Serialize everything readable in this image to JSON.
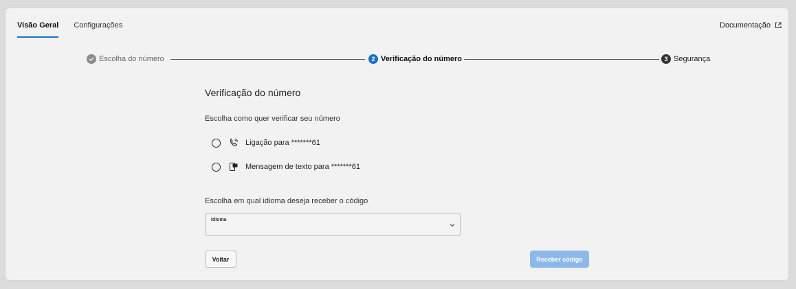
{
  "tabs": [
    {
      "label": "Visão Geral",
      "active": true
    },
    {
      "label": "Configurações",
      "active": false
    }
  ],
  "doc_link": {
    "label": "Documentação",
    "icon": "external-link-icon"
  },
  "stepper": {
    "steps": [
      {
        "number": "",
        "label": "Escolha do número",
        "state": "done",
        "icon": "check-icon"
      },
      {
        "number": "2",
        "label": "Verificação do número",
        "state": "current"
      },
      {
        "number": "3",
        "label": "Segurança",
        "state": "pending"
      }
    ]
  },
  "main": {
    "title": "Verificação do número",
    "method_prompt": "Escolha como quer verificar seu número",
    "options": [
      {
        "label": "Ligação para *******61",
        "icon": "phone-call-icon",
        "selected": false
      },
      {
        "label": "Mensagem de texto para *******61",
        "icon": "sms-message-icon",
        "selected": false
      }
    ],
    "language_prompt": "Escolha em qual idioma deseja receber o código",
    "language_select": {
      "label": "Idioma",
      "value": ""
    },
    "back_label": "Voltar",
    "submit_label": "Receber código"
  },
  "colors": {
    "accent": "#1a73c8",
    "submit_disabled": "#8db8ea",
    "background": "#dcdcdc",
    "card": "#f2f2f2"
  }
}
